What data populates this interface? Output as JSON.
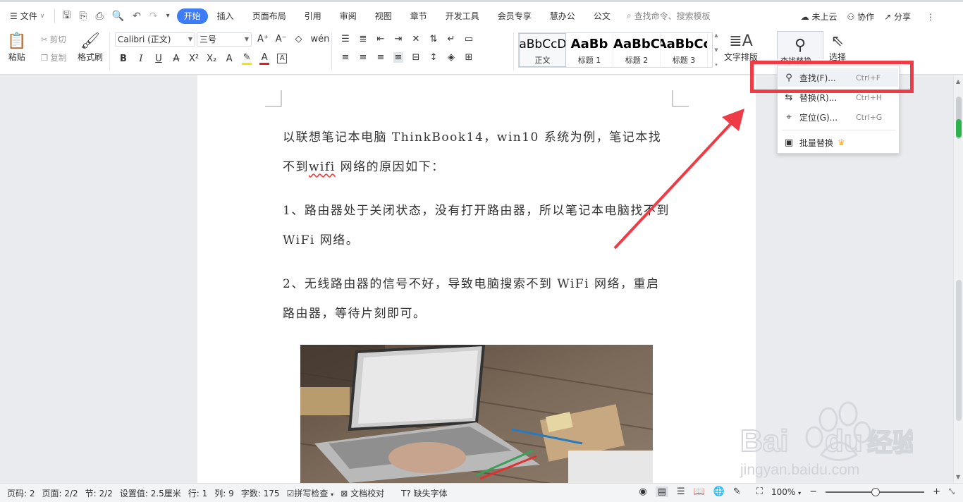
{
  "menubar": {
    "file_label": "文件",
    "tabs": [
      "开始",
      "插入",
      "页面布局",
      "引用",
      "审阅",
      "视图",
      "章节",
      "开发工具",
      "会员专享",
      "慧办公",
      "公文"
    ],
    "active_tab": "开始",
    "search_placeholder": "查找命令、搜索模板",
    "cloud_label": "未上云",
    "collab_label": "协作",
    "share_label": "分享"
  },
  "ribbon": {
    "paste_label": "粘贴",
    "cut_label": "剪切",
    "copy_label": "复制",
    "format_painter_label": "格式刷",
    "font_name": "Calibri (正文)",
    "font_size": "三号",
    "styles": [
      {
        "preview": "AaBbCcDd",
        "name": "正文"
      },
      {
        "preview": "AaBb",
        "name": "标题 1"
      },
      {
        "preview": "AaBbC",
        "name": "标题 2"
      },
      {
        "preview": "AaBbCc",
        "name": "标题 3"
      }
    ],
    "text_layout_label": "文字排版",
    "find_replace_label": "查找替换",
    "select_label": "选择"
  },
  "dropdown": {
    "items": [
      {
        "label": "查找(F)...",
        "shortcut": "Ctrl+F"
      },
      {
        "label": "替换(R)...",
        "shortcut": "Ctrl+H"
      },
      {
        "label": "定位(G)...",
        "shortcut": "Ctrl+G"
      },
      {
        "label": "批量替换",
        "shortcut": ""
      }
    ]
  },
  "document": {
    "p1_a": "以联想笔记本电脑 ThinkBook14，win10 系统为例，笔记本找不到",
    "p1_wifi": "wifi",
    "p1_b": "网络的原因如下：",
    "p2": "1、路由器处于关闭状态，没有打开路由器，所以笔记本电脑找不到 WiFi 网络。",
    "p3": "2、无线路由器的信号不好，导致电脑搜索不到 WiFi 网络，重启路由器，等待片刻即可。"
  },
  "status": {
    "page_no": "页码: 2",
    "pages": "页面: 2/2",
    "section": "节: 2/2",
    "setting": "设置值: 2.5厘米",
    "row": "行: 1",
    "col": "列: 9",
    "words": "字数: 175",
    "spell": "拼写检查",
    "proof": "文档校对",
    "missing_font": "缺失字体",
    "zoom": "100%"
  },
  "colors": {
    "accent": "#3c7cf6",
    "highlight_red": "#ef3b45"
  }
}
